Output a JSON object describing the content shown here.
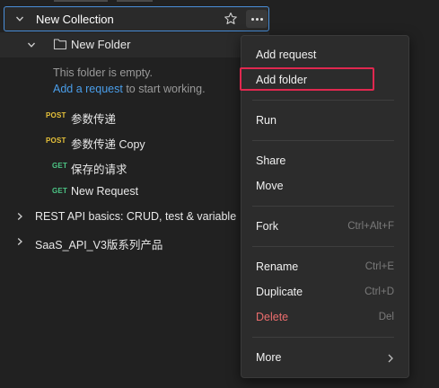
{
  "collection": {
    "name": "New Collection"
  },
  "folder": {
    "name": "New Folder",
    "empty_text": "This folder is empty.",
    "add_request_link": "Add a request",
    "add_request_suffix": " to start working."
  },
  "requests": [
    {
      "method": "POST",
      "name": "参数传递"
    },
    {
      "method": "POST",
      "name": "参数传递 Copy"
    },
    {
      "method": "GET",
      "name": "保存的请求"
    },
    {
      "method": "GET",
      "name": "New Request"
    }
  ],
  "collections": [
    {
      "name": "REST API basics: CRUD, test & variable"
    },
    {
      "name": "SaaS_API_V3版系列产品"
    }
  ],
  "menu": {
    "items": [
      {
        "label": "Add request"
      },
      {
        "label": "Add folder"
      },
      {
        "label": "Run"
      },
      {
        "label": "Share"
      },
      {
        "label": "Move"
      },
      {
        "label": "Fork",
        "shortcut": "Ctrl+Alt+F"
      },
      {
        "label": "Rename",
        "shortcut": "Ctrl+E"
      },
      {
        "label": "Duplicate",
        "shortcut": "Ctrl+D"
      },
      {
        "label": "Delete",
        "shortcut": "Del"
      },
      {
        "label": "More"
      }
    ]
  },
  "colors": {
    "post": "#e8c33a",
    "get": "#4cc585",
    "link": "#4a9eea",
    "delete": "#eb6d6d",
    "highlight": "#e0284f",
    "selection_border": "#4a8fd9"
  },
  "icons": {
    "collection_chevron": "chevron-down-icon",
    "folder": "folder-icon",
    "star": "star-icon",
    "more": "more-horizontal-icon",
    "submenu": "chevron-right-icon"
  }
}
